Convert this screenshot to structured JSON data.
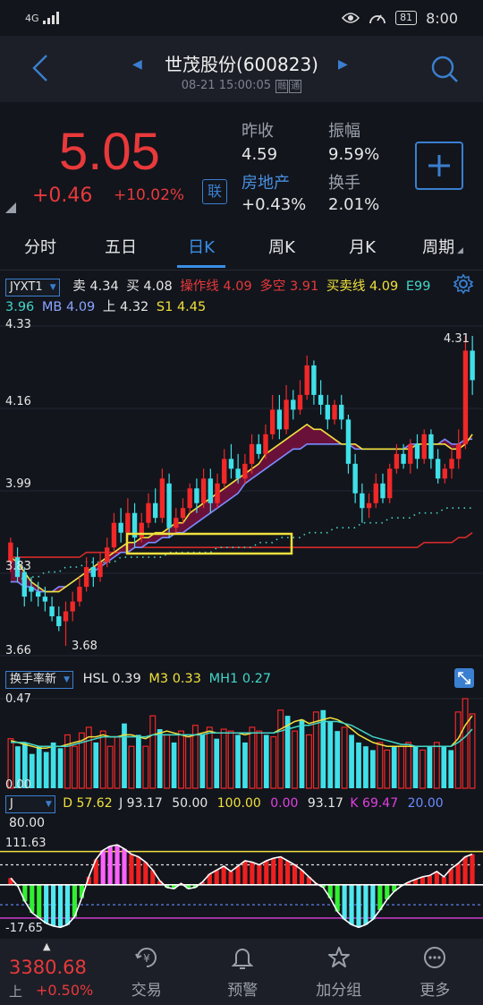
{
  "status": {
    "network": "4G",
    "battery": "81",
    "time": "8:00"
  },
  "header": {
    "title": "世茂股份(600823)",
    "datetime": "08-21 15:00:05",
    "tag1": "融",
    "tag2": "通"
  },
  "quote": {
    "price": "5.05",
    "change": "+0.46",
    "change_pct": "+10.02%",
    "lian": "联",
    "prev_close_label": "昨收",
    "prev_close": "4.59",
    "amplitude_label": "振幅",
    "amplitude": "9.59%",
    "sector_label": "房地产",
    "sector": "+0.43%",
    "turnover_label": "换手",
    "turnover": "2.01%",
    "colors": {
      "up": "#e8393b",
      "accent": "#3a7fd0"
    }
  },
  "tabs": [
    "分时",
    "五日",
    "日K",
    "周K",
    "月K",
    "周期"
  ],
  "active_tab": "日K",
  "indicator_main": {
    "select": "JYXT1",
    "sell_label": "卖",
    "sell": "4.34",
    "buy_label": "买",
    "buy": "4.08",
    "op_label": "操作线",
    "op": "4.09",
    "dk_label": "多空",
    "dk": "3.91",
    "mm_label": "买卖线",
    "mm": "4.09",
    "e99_label": "E99",
    "e99": "3.96",
    "mb_label": "MB",
    "mb": "4.09",
    "up_label": "上",
    "up": "4.32",
    "s1_label": "S1",
    "s1": "4.45"
  },
  "indicator_vol": {
    "select": "换手率新",
    "hsl_label": "HSL",
    "hsl": "0.39",
    "m3_label": "M3",
    "m3": "0.33",
    "mh1_label": "MH1",
    "mh1": "0.27"
  },
  "indicator_kdj": {
    "select": "J",
    "d_label": "D",
    "d": "57.62",
    "j_label": "J",
    "j": "93.17",
    "v50": "50.00",
    "v100": "100.00",
    "v0": "0.00",
    "v93": "93.17",
    "k_label": "K",
    "k": "69.47",
    "v20": "20.00",
    "v80": "80.00"
  },
  "chart_data": [
    {
      "type": "candlestick",
      "title": "",
      "ylim": [
        3.66,
        4.33
      ],
      "y_ticks": [
        "4.33",
        "4.16",
        "3.99",
        "3.83",
        "3.66"
      ],
      "annotations": [
        "4.31",
        "3.68"
      ],
      "candles": [
        {
          "o": 3.85,
          "c": 3.89,
          "h": 3.9,
          "l": 3.83
        },
        {
          "o": 3.86,
          "c": 3.82,
          "h": 3.88,
          "l": 3.81
        },
        {
          "o": 3.83,
          "c": 3.78,
          "h": 3.84,
          "l": 3.76
        },
        {
          "o": 3.8,
          "c": 3.79,
          "h": 3.82,
          "l": 3.77
        },
        {
          "o": 3.79,
          "c": 3.78,
          "h": 3.81,
          "l": 3.76
        },
        {
          "o": 3.78,
          "c": 3.77,
          "h": 3.8,
          "l": 3.75
        },
        {
          "o": 3.76,
          "c": 3.74,
          "h": 3.78,
          "l": 3.73
        },
        {
          "o": 3.74,
          "c": 3.72,
          "h": 3.76,
          "l": 3.71
        },
        {
          "o": 3.73,
          "c": 3.75,
          "h": 3.77,
          "l": 3.68
        },
        {
          "o": 3.75,
          "c": 3.77,
          "h": 3.79,
          "l": 3.73
        },
        {
          "o": 3.77,
          "c": 3.8,
          "h": 3.82,
          "l": 3.76
        },
        {
          "o": 3.8,
          "c": 3.84,
          "h": 3.86,
          "l": 3.79
        },
        {
          "o": 3.84,
          "c": 3.82,
          "h": 3.86,
          "l": 3.8
        },
        {
          "o": 3.82,
          "c": 3.85,
          "h": 3.87,
          "l": 3.81
        },
        {
          "o": 3.85,
          "c": 3.88,
          "h": 3.9,
          "l": 3.84
        },
        {
          "o": 3.88,
          "c": 3.93,
          "h": 3.95,
          "l": 3.87
        },
        {
          "o": 3.93,
          "c": 3.91,
          "h": 3.96,
          "l": 3.89
        },
        {
          "o": 3.91,
          "c": 3.95,
          "h": 3.98,
          "l": 3.9
        },
        {
          "o": 3.95,
          "c": 3.9,
          "h": 3.97,
          "l": 3.88
        },
        {
          "o": 3.9,
          "c": 3.93,
          "h": 3.95,
          "l": 3.89
        },
        {
          "o": 3.93,
          "c": 3.97,
          "h": 3.99,
          "l": 3.92
        },
        {
          "o": 3.97,
          "c": 3.94,
          "h": 4.0,
          "l": 3.93
        },
        {
          "o": 3.94,
          "c": 4.02,
          "h": 4.04,
          "l": 3.93
        },
        {
          "o": 4.01,
          "c": 3.92,
          "h": 4.03,
          "l": 3.9
        },
        {
          "o": 3.92,
          "c": 3.94,
          "h": 3.96,
          "l": 3.91
        },
        {
          "o": 3.94,
          "c": 3.96,
          "h": 3.98,
          "l": 3.93
        },
        {
          "o": 3.96,
          "c": 4.0,
          "h": 4.01,
          "l": 3.95
        },
        {
          "o": 4.0,
          "c": 3.97,
          "h": 4.02,
          "l": 3.95
        },
        {
          "o": 3.97,
          "c": 4.02,
          "h": 4.04,
          "l": 3.96
        },
        {
          "o": 4.02,
          "c": 3.97,
          "h": 4.04,
          "l": 3.95
        },
        {
          "o": 3.97,
          "c": 4.01,
          "h": 4.03,
          "l": 3.96
        },
        {
          "o": 4.01,
          "c": 4.06,
          "h": 4.08,
          "l": 4.0
        },
        {
          "o": 4.06,
          "c": 4.04,
          "h": 4.09,
          "l": 4.02
        },
        {
          "o": 4.04,
          "c": 4.02,
          "h": 4.07,
          "l": 4.01
        },
        {
          "o": 4.02,
          "c": 4.05,
          "h": 4.07,
          "l": 4.01
        },
        {
          "o": 4.05,
          "c": 4.09,
          "h": 4.11,
          "l": 4.03
        },
        {
          "o": 4.09,
          "c": 4.07,
          "h": 4.11,
          "l": 4.06
        },
        {
          "o": 4.07,
          "c": 4.11,
          "h": 4.13,
          "l": 4.06
        },
        {
          "o": 4.11,
          "c": 4.16,
          "h": 4.19,
          "l": 4.1
        },
        {
          "o": 4.16,
          "c": 4.12,
          "h": 4.19,
          "l": 4.1
        },
        {
          "o": 4.12,
          "c": 4.18,
          "h": 4.21,
          "l": 4.11
        },
        {
          "o": 4.18,
          "c": 4.16,
          "h": 4.2,
          "l": 4.14
        },
        {
          "o": 4.16,
          "c": 4.19,
          "h": 4.22,
          "l": 4.15
        },
        {
          "o": 4.19,
          "c": 4.25,
          "h": 4.27,
          "l": 4.18
        },
        {
          "o": 4.25,
          "c": 4.19,
          "h": 4.26,
          "l": 4.17
        },
        {
          "o": 4.19,
          "c": 4.17,
          "h": 4.22,
          "l": 4.15
        },
        {
          "o": 4.17,
          "c": 4.14,
          "h": 4.19,
          "l": 4.12
        },
        {
          "o": 4.14,
          "c": 4.17,
          "h": 4.18,
          "l": 4.13
        },
        {
          "o": 4.17,
          "c": 4.14,
          "h": 4.19,
          "l": 4.12
        },
        {
          "o": 4.14,
          "c": 4.05,
          "h": 4.15,
          "l": 4.03
        },
        {
          "o": 4.05,
          "c": 3.99,
          "h": 4.07,
          "l": 3.97
        },
        {
          "o": 3.99,
          "c": 3.96,
          "h": 4.01,
          "l": 3.93
        },
        {
          "o": 3.96,
          "c": 3.97,
          "h": 3.99,
          "l": 3.94
        },
        {
          "o": 3.97,
          "c": 4.01,
          "h": 4.03,
          "l": 3.96
        },
        {
          "o": 4.01,
          "c": 3.98,
          "h": 4.03,
          "l": 3.97
        },
        {
          "o": 3.98,
          "c": 4.04,
          "h": 4.05,
          "l": 3.97
        },
        {
          "o": 4.04,
          "c": 4.07,
          "h": 4.09,
          "l": 4.03
        },
        {
          "o": 4.07,
          "c": 4.05,
          "h": 4.09,
          "l": 4.04
        },
        {
          "o": 4.05,
          "c": 4.09,
          "h": 4.1,
          "l": 4.03
        },
        {
          "o": 4.09,
          "c": 4.06,
          "h": 4.11,
          "l": 4.04
        },
        {
          "o": 4.06,
          "c": 4.11,
          "h": 4.12,
          "l": 4.05
        },
        {
          "o": 4.11,
          "c": 4.06,
          "h": 4.12,
          "l": 4.04
        },
        {
          "o": 4.06,
          "c": 4.02,
          "h": 4.08,
          "l": 4.01
        },
        {
          "o": 4.02,
          "c": 4.04,
          "h": 4.05,
          "l": 4.01
        },
        {
          "o": 4.04,
          "c": 4.06,
          "h": 4.08,
          "l": 4.02
        },
        {
          "o": 4.06,
          "c": 4.09,
          "h": 4.12,
          "l": 4.04
        },
        {
          "o": 4.09,
          "c": 4.28,
          "h": 4.31,
          "l": 4.08
        },
        {
          "o": 4.28,
          "c": 4.22,
          "h": 4.31,
          "l": 4.19
        }
      ],
      "lines": {
        "yellow": [
          3.86,
          3.85,
          3.83,
          3.81,
          3.8,
          3.79,
          3.79,
          3.79,
          3.8,
          3.81,
          3.82,
          3.83,
          3.84,
          3.85,
          3.86,
          3.87,
          3.88,
          3.89,
          3.89,
          3.9,
          3.9,
          3.91,
          3.91,
          3.92,
          3.93,
          3.93,
          3.95,
          3.96,
          3.97,
          3.98,
          3.99,
          4.0,
          4.01,
          4.02,
          4.03,
          4.04,
          4.05,
          4.07,
          4.08,
          4.09,
          4.1,
          4.11,
          4.12,
          4.13,
          4.12,
          4.12,
          4.11,
          4.1,
          4.09,
          4.09,
          4.09,
          4.08,
          4.08,
          4.08,
          4.08,
          4.08,
          4.08,
          4.08,
          4.08,
          4.09,
          4.09,
          4.09,
          4.09,
          4.09,
          4.08,
          4.08,
          4.09,
          4.11
        ],
        "blue": [
          3.81,
          3.81,
          3.8,
          3.8,
          3.79,
          3.79,
          3.79,
          3.8,
          3.8,
          3.81,
          3.82,
          3.83,
          3.83,
          3.84,
          3.85,
          3.86,
          3.87,
          3.87,
          3.88,
          3.88,
          3.89,
          3.89,
          3.9,
          3.9,
          3.91,
          3.91,
          3.92,
          3.93,
          3.94,
          3.95,
          3.96,
          3.97,
          3.98,
          3.99,
          4.01,
          4.02,
          4.03,
          4.04,
          4.05,
          4.06,
          4.07,
          4.08,
          4.08,
          4.09,
          4.09,
          4.09,
          4.09,
          4.09,
          4.09,
          4.09,
          4.08,
          4.08,
          4.08,
          4.08,
          4.08,
          4.08,
          4.08,
          4.08,
          4.09,
          4.09,
          4.09,
          4.09,
          4.09,
          4.1,
          4.09,
          4.09,
          4.1,
          4.1
        ],
        "red": [
          3.86,
          3.86,
          3.86,
          3.86,
          3.86,
          3.86,
          3.86,
          3.86,
          3.86,
          3.86,
          3.86,
          3.87,
          3.87,
          3.87,
          3.87,
          3.87,
          3.87,
          3.87,
          3.88,
          3.88,
          3.88,
          3.88,
          3.88,
          3.88,
          3.88,
          3.88,
          3.88,
          3.88,
          3.88,
          3.88,
          3.88,
          3.88,
          3.88,
          3.88,
          3.88,
          3.88,
          3.88,
          3.88,
          3.88,
          3.88,
          3.88,
          3.88,
          3.88,
          3.88,
          3.88,
          3.88,
          3.88,
          3.88,
          3.88,
          3.88,
          3.88,
          3.88,
          3.88,
          3.88,
          3.88,
          3.88,
          3.88,
          3.88,
          3.88,
          3.88,
          3.89,
          3.89,
          3.89,
          3.89,
          3.89,
          3.9,
          3.9,
          3.91
        ],
        "dotted": [
          3.81,
          3.81,
          3.82,
          3.82,
          3.82,
          3.83,
          3.83,
          3.83,
          3.84,
          3.84,
          3.84,
          3.85,
          3.85,
          3.85,
          3.85,
          3.85,
          3.86,
          3.86,
          3.86,
          3.86,
          3.86,
          3.86,
          3.86,
          3.87,
          3.87,
          3.87,
          3.87,
          3.87,
          3.87,
          3.87,
          3.88,
          3.88,
          3.88,
          3.88,
          3.88,
          3.88,
          3.89,
          3.89,
          3.89,
          3.9,
          3.9,
          3.9,
          3.9,
          3.91,
          3.91,
          3.91,
          3.91,
          3.92,
          3.92,
          3.92,
          3.92,
          3.93,
          3.93,
          3.93,
          3.93,
          3.94,
          3.94,
          3.94,
          3.94,
          3.95,
          3.95,
          3.95,
          3.95,
          3.96,
          3.96,
          3.96,
          3.96,
          3.96
        ]
      }
    },
    {
      "type": "bar",
      "title": "换手率新",
      "ymax_label": "0.47",
      "ymin_label": "0.00",
      "ylim": [
        0,
        0.47
      ],
      "values": [
        0.26,
        0.22,
        0.24,
        0.18,
        0.22,
        0.19,
        0.24,
        0.21,
        0.28,
        0.22,
        0.29,
        0.32,
        0.24,
        0.3,
        0.22,
        0.27,
        0.34,
        0.22,
        0.28,
        0.22,
        0.38,
        0.31,
        0.28,
        0.24,
        0.3,
        0.27,
        0.33,
        0.28,
        0.32,
        0.26,
        0.31,
        0.3,
        0.28,
        0.24,
        0.32,
        0.3,
        0.28,
        0.27,
        0.41,
        0.38,
        0.3,
        0.36,
        0.28,
        0.4,
        0.41,
        0.35,
        0.3,
        0.32,
        0.28,
        0.24,
        0.22,
        0.2,
        0.24,
        0.2,
        0.22,
        0.22,
        0.24,
        0.22,
        0.2,
        0.22,
        0.24,
        0.22,
        0.2,
        0.4,
        0.47,
        0.39
      ],
      "ma_yellow": [
        0.25,
        0.24,
        0.23,
        0.22,
        0.21,
        0.21,
        0.22,
        0.22,
        0.23,
        0.24,
        0.25,
        0.27,
        0.27,
        0.28,
        0.27,
        0.27,
        0.28,
        0.28,
        0.27,
        0.26,
        0.28,
        0.29,
        0.3,
        0.29,
        0.28,
        0.27,
        0.28,
        0.29,
        0.3,
        0.29,
        0.29,
        0.29,
        0.29,
        0.28,
        0.29,
        0.29,
        0.29,
        0.29,
        0.31,
        0.33,
        0.35,
        0.36,
        0.34,
        0.35,
        0.36,
        0.37,
        0.36,
        0.34,
        0.31,
        0.28,
        0.26,
        0.24,
        0.23,
        0.22,
        0.22,
        0.22,
        0.22,
        0.22,
        0.22,
        0.22,
        0.22,
        0.22,
        0.22,
        0.26,
        0.33,
        0.38
      ],
      "ma_cyan": [
        0.24,
        0.24,
        0.24,
        0.23,
        0.22,
        0.22,
        0.22,
        0.22,
        0.22,
        0.23,
        0.24,
        0.25,
        0.26,
        0.27,
        0.27,
        0.27,
        0.27,
        0.27,
        0.27,
        0.27,
        0.28,
        0.28,
        0.28,
        0.28,
        0.28,
        0.28,
        0.28,
        0.28,
        0.29,
        0.29,
        0.29,
        0.29,
        0.29,
        0.29,
        0.29,
        0.29,
        0.29,
        0.29,
        0.3,
        0.31,
        0.32,
        0.33,
        0.33,
        0.34,
        0.35,
        0.35,
        0.35,
        0.34,
        0.33,
        0.31,
        0.29,
        0.27,
        0.26,
        0.25,
        0.24,
        0.23,
        0.23,
        0.22,
        0.22,
        0.22,
        0.22,
        0.22,
        0.22,
        0.24,
        0.27,
        0.31
      ]
    },
    {
      "type": "bar",
      "title": "J",
      "y_labels": [
        "111.63",
        "-17.65"
      ],
      "ylim": [
        -17.65,
        111.63
      ],
      "values": [
        60,
        48,
        25,
        8,
        0,
        -8,
        -12,
        -14,
        -10,
        2,
        30,
        62,
        88,
        102,
        108,
        110,
        104,
        96,
        92,
        84,
        72,
        56,
        46,
        44,
        52,
        44,
        46,
        54,
        66,
        72,
        78,
        70,
        78,
        86,
        84,
        80,
        86,
        90,
        92,
        86,
        80,
        72,
        62,
        52,
        46,
        30,
        10,
        -2,
        -10,
        -14,
        -10,
        -2,
        12,
        28,
        40,
        48,
        54,
        58,
        62,
        64,
        70,
        62,
        74,
        82,
        92,
        96
      ]
    }
  ],
  "bottom_nav": {
    "index_value": "3380.68",
    "index_name": "上",
    "index_change": "+0.50%",
    "trade": "交易",
    "alert": "预警",
    "add_group": "加分组",
    "more": "更多"
  }
}
